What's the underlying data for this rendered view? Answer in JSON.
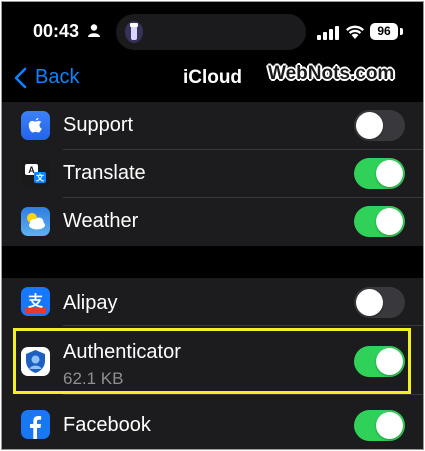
{
  "status_bar": {
    "time": "00:43",
    "battery": "96",
    "icons": [
      "person-icon",
      "flashlight-icon",
      "cellular-signal-icon",
      "wifi-icon",
      "battery-icon"
    ]
  },
  "nav": {
    "back_label": "Back",
    "title": "iCloud",
    "watermark": "WebNots.com"
  },
  "group1": [
    {
      "label": "Support",
      "icon": "apple-support-icon",
      "on": false
    },
    {
      "label": "Translate",
      "icon": "translate-icon",
      "on": true
    },
    {
      "label": "Weather",
      "icon": "weather-icon",
      "on": true
    }
  ],
  "group2": [
    {
      "label": "Alipay",
      "icon": "alipay-icon",
      "on": false
    },
    {
      "label": "Authenticator",
      "subtitle": "62.1 KB",
      "icon": "authenticator-icon",
      "on": true,
      "highlighted": true
    },
    {
      "label": "Facebook",
      "icon": "facebook-icon",
      "on": true
    }
  ],
  "colors": {
    "accent": "#0a84ff",
    "toggle_on": "#30d158",
    "toggle_off": "#39393d",
    "highlight": "#f2ef23",
    "cell_bg": "#1c1c1e"
  }
}
